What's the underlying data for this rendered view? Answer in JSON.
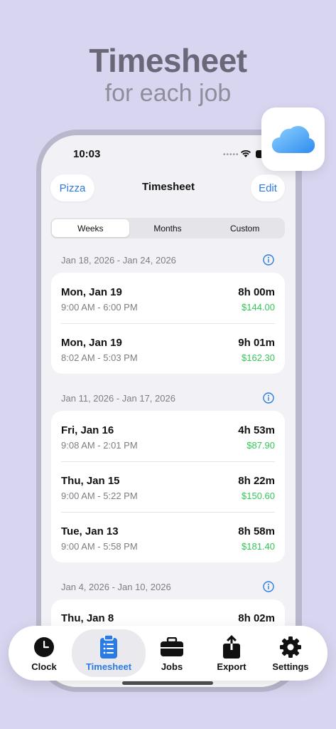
{
  "hero": {
    "title": "Timesheet",
    "subtitle": "for each job"
  },
  "status": {
    "time": "10:03",
    "dots": "•••••"
  },
  "nav": {
    "back_label": "Pizza",
    "title": "Timesheet",
    "edit_label": "Edit"
  },
  "segments": {
    "items": [
      "Weeks",
      "Months",
      "Custom"
    ],
    "selected": "Weeks"
  },
  "weeks": [
    {
      "range": "Jan 18, 2026 - Jan 24, 2026",
      "entries": [
        {
          "date": "Mon, Jan 19",
          "time_range": "9:00 AM - 6:00 PM",
          "hours": "8h 00m",
          "pay": "$144.00"
        },
        {
          "date": "Mon, Jan 19",
          "time_range": "8:02 AM - 5:03 PM",
          "hours": "9h 01m",
          "pay": "$162.30"
        }
      ]
    },
    {
      "range": "Jan 11, 2026 - Jan 17, 2026",
      "entries": [
        {
          "date": "Fri, Jan 16",
          "time_range": "9:08 AM - 2:01 PM",
          "hours": "4h 53m",
          "pay": "$87.90"
        },
        {
          "date": "Thu, Jan 15",
          "time_range": "9:00 AM - 5:22 PM",
          "hours": "8h 22m",
          "pay": "$150.60"
        },
        {
          "date": "Tue, Jan 13",
          "time_range": "9:00 AM - 5:58 PM",
          "hours": "8h 58m",
          "pay": "$181.40"
        }
      ]
    },
    {
      "range": "Jan 4, 2026 - Jan 10, 2026",
      "entries": [
        {
          "date": "Thu, Jan 8",
          "time_range": "",
          "hours": "8h 02m",
          "pay": ""
        }
      ]
    }
  ],
  "tabbar": {
    "items": [
      {
        "label": "Clock",
        "icon": "clock-icon"
      },
      {
        "label": "Timesheet",
        "icon": "clipboard-list-icon"
      },
      {
        "label": "Jobs",
        "icon": "briefcase-icon"
      },
      {
        "label": "Export",
        "icon": "share-icon"
      },
      {
        "label": "Settings",
        "icon": "gear-icon"
      }
    ],
    "selected": "Timesheet"
  },
  "colors": {
    "accent": "#2a7be4",
    "pay_green": "#34c759",
    "background": "#d8d5f0"
  }
}
